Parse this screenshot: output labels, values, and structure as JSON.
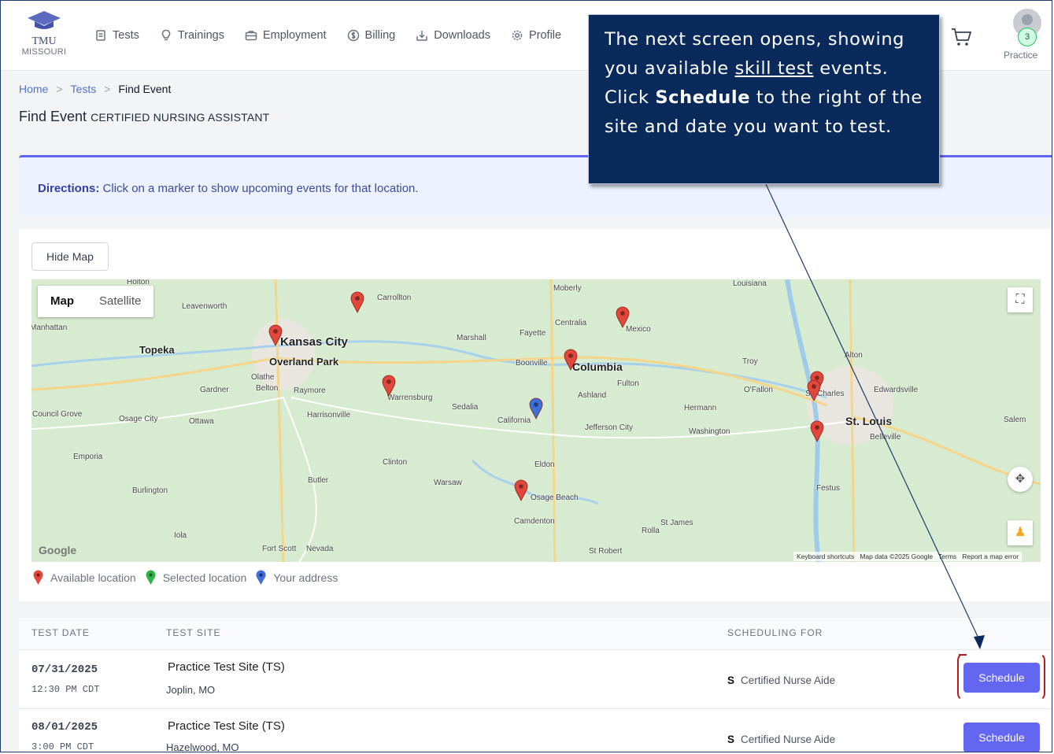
{
  "header": {
    "logo_line1": "TMU",
    "logo_line2": "MISSOURI",
    "nav": [
      {
        "label": "Tests",
        "icon": "document-icon"
      },
      {
        "label": "Trainings",
        "icon": "lightbulb-icon"
      },
      {
        "label": "Employment",
        "icon": "briefcase-icon"
      },
      {
        "label": "Billing",
        "icon": "dollar-icon"
      },
      {
        "label": "Downloads",
        "icon": "download-icon"
      },
      {
        "label": "Profile",
        "icon": "gear-icon"
      }
    ],
    "cart_icon": "cart-icon",
    "notification_count": "3",
    "user_label": "Practice"
  },
  "breadcrumb": {
    "home": "Home",
    "tests": "Tests",
    "current": "Find Event"
  },
  "page": {
    "title": "Find Event",
    "subtitle": "CERTIFIED NURSING ASSISTANT"
  },
  "directions": {
    "label": "Directions:",
    "text": "Click on a marker to show upcoming events for that location."
  },
  "map": {
    "hide_button": "Hide Map",
    "type_map": "Map",
    "type_satellite": "Satellite",
    "logo": "Google",
    "footer_shortcuts": "Keyboard shortcuts",
    "footer_data": "Map data ©2025 Google",
    "footer_terms": "Terms",
    "footer_report": "Report a map error",
    "cities": [
      "Kansas City",
      "Overland Park",
      "Topeka",
      "Columbia",
      "St. Louis",
      "Jefferson City",
      "Warrensburg",
      "Sedalia",
      "Carrollton",
      "Moberly",
      "Mexico",
      "Centralia",
      "Fayette",
      "Marshall",
      "Boonville",
      "Fulton",
      "Ashland",
      "California",
      "Hermann",
      "Washington",
      "Eldon",
      "Osage Beach",
      "Camdenton",
      "Warsaw",
      "Clinton",
      "Butler",
      "Harrisonville",
      "Raymore",
      "Belton",
      "Olathe",
      "Gardner",
      "Ottawa",
      "Osage City",
      "Council Grove",
      "Emporia",
      "Burlington",
      "Iola",
      "Fort Scott",
      "Nevada",
      "Rolla",
      "St James",
      "St Robert",
      "Festus",
      "Belleville",
      "Edwardsville",
      "Alton",
      "St. Charles",
      "O'Fallon",
      "Troy",
      "Louisiana",
      "Salem",
      "Leavenworth",
      "Holton",
      "Manhattan"
    ],
    "legend": {
      "available": "Available location",
      "selected": "Selected location",
      "address": "Your address"
    }
  },
  "table": {
    "headers": {
      "date": "TEST DATE",
      "site": "TEST SITE",
      "for": "SCHEDULING FOR"
    },
    "rows": [
      {
        "date": "07/31/2025",
        "time": "12:30 PM CDT",
        "site": "Practice Test Site (TS)",
        "city": "Joplin, MO",
        "for_code": "S",
        "for_text": "Certified Nurse Aide",
        "button": "Schedule"
      },
      {
        "date": "08/01/2025",
        "time": "3:00 PM CDT",
        "site": "Practice Test Site (TS)",
        "city": "Hazelwood, MO",
        "for_code": "S",
        "for_text": "Certified Nurse Aide",
        "button": "Schedule"
      }
    ]
  },
  "callout": {
    "t1": "The next screen opens, showing you available ",
    "link": "skill test",
    "t2": " events. Click ",
    "bold": "Schedule",
    "t3": " to the right of the site and date you want to test."
  },
  "colors": {
    "accent": "#6366f1",
    "callout_bg": "#0b2a5c",
    "marker_red": "#e2473b",
    "marker_blue": "#3f6fd8",
    "marker_green": "#2fb34a",
    "bracket": "#b91c1c"
  }
}
